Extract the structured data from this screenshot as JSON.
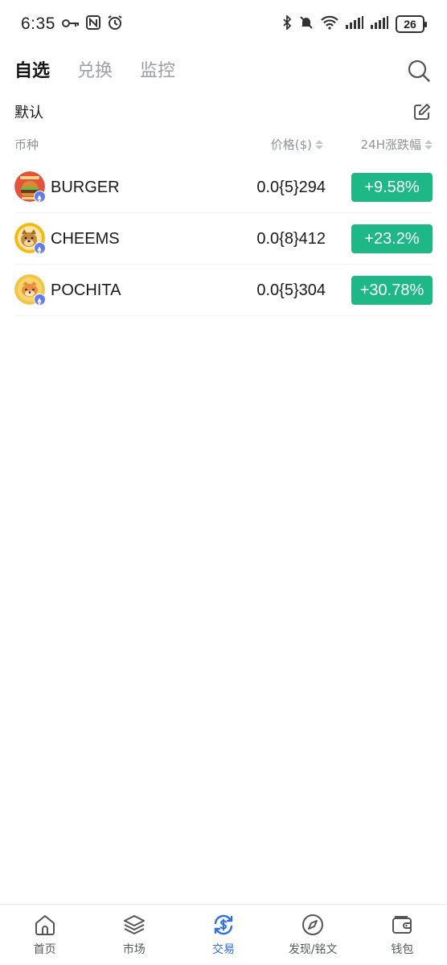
{
  "status_bar": {
    "time": "6:35",
    "battery": "26",
    "icons": [
      "key-icon",
      "nfc-icon",
      "alarm-icon",
      "bluetooth-icon",
      "mute-icon",
      "wifi-icon",
      "signal-icon",
      "signal-icon"
    ]
  },
  "tabs": [
    {
      "label": "自选",
      "active": true
    },
    {
      "label": "兑换",
      "active": false
    },
    {
      "label": "监控",
      "active": false
    }
  ],
  "group": {
    "title": "默认"
  },
  "columns": {
    "coin": "币种",
    "price": "价格($)",
    "change": "24H涨跌幅"
  },
  "coins": [
    {
      "name": "BURGER",
      "price": "0.0{5}294",
      "change": "+9.58%",
      "icon": "burger-token-icon"
    },
    {
      "name": "CHEEMS",
      "price": "0.0{8}412",
      "change": "+23.2%",
      "icon": "cheems-token-icon"
    },
    {
      "name": "POCHITA",
      "price": "0.0{5}304",
      "change": "+30.78%",
      "icon": "pochita-token-icon"
    }
  ],
  "colors": {
    "positive": "#1db885",
    "accent": "#2f6fe4",
    "chain_badge": "#627eea"
  },
  "bottom_nav": [
    {
      "label": "首页",
      "icon": "home-icon",
      "active": false
    },
    {
      "label": "市场",
      "icon": "layers-icon",
      "active": false
    },
    {
      "label": "交易",
      "icon": "swap-dollar-icon",
      "active": true
    },
    {
      "label": "发现/铭文",
      "icon": "compass-icon",
      "active": false
    },
    {
      "label": "钱包",
      "icon": "wallet-icon",
      "active": false
    }
  ]
}
